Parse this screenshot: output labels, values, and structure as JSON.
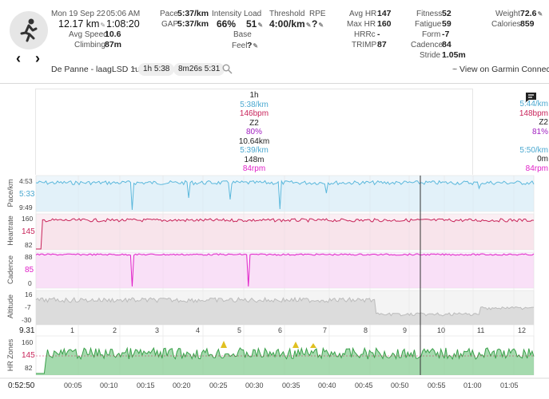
{
  "header": {
    "date": "Mon 19 Sep 22",
    "time": "05:06 AM",
    "distance": "12.17 km",
    "duration": "1:08:20",
    "avg_speed_label": "Avg Speed",
    "avg_speed": "10.6",
    "climbing_label": "Climbing",
    "climbing": "87m",
    "pace_label": "Pace",
    "pace": "5:37/km",
    "gap_label": "GAP",
    "gap": "5:37/km",
    "intensity_label": "Intensity",
    "intensity": "66%",
    "load_label": "Load",
    "load": "51",
    "base_label": "Base",
    "feel_label": "Feel",
    "feel": "?",
    "threshold_label": "Threshold",
    "threshold": "4:00/km",
    "rpe_label": "RPE",
    "rpe": "?",
    "avghr_label": "Avg HR",
    "avghr": "147",
    "maxhr_label": "Max HR",
    "maxhr": "160",
    "hrrc_label": "HRRc",
    "hrrc": "-",
    "trimp_label": "TRIMP",
    "trimp": "87",
    "fitness_label": "Fitness",
    "fitness": "52",
    "fatigue_label": "Fatigue",
    "fatigue": "59",
    "form_label": "Form",
    "form": "-7",
    "cadence_label": "Cadence",
    "cadence": "84",
    "stride_label": "Stride",
    "stride": "1.05m",
    "weight_label": "Weight",
    "weight": "72.6",
    "calories_label": "Calories",
    "calories": "859"
  },
  "nav": {
    "prev": "‹",
    "next": "›"
  },
  "activity": {
    "name": "De Panne - laagLSD 1u",
    "tilde": "~",
    "pill1": "1h 5:38",
    "pill2": "8m26s 5:31",
    "garmin_link": "~ View on Garmin Connect"
  },
  "tooltip1": [
    "1h",
    "5:38/km",
    "146bpm",
    "Z2",
    "80%",
    "10.64km",
    "5:39/km",
    "148m",
    "84rpm"
  ],
  "tooltip2": [
    "5:44/km",
    "148bpm",
    "Z2",
    "81%",
    "5:50/km",
    "0m",
    "84rpm"
  ],
  "charts": {
    "pace": {
      "label": "Pace/km",
      "ticks": [
        "4:53",
        "5:33",
        "9:49"
      ]
    },
    "hr": {
      "label": "Heartrate",
      "ticks": [
        "160",
        "145",
        "82"
      ]
    },
    "cadence": {
      "label": "Cadence",
      "ticks": [
        "88",
        "85",
        "0"
      ]
    },
    "altitude": {
      "label": "Altitude",
      "ticks": [
        "16",
        "-7",
        "-30"
      ]
    },
    "laps": {
      "start": "9.31",
      "items": [
        "1",
        "2",
        "3",
        "4",
        "5",
        "6",
        "7",
        "8",
        "9",
        "10",
        "11",
        "12"
      ]
    },
    "zones": {
      "label": "HR Zones",
      "ticks": [
        "160",
        "145",
        "82"
      ]
    }
  },
  "time_axis": [
    "0:52:50",
    "00:05",
    "00:10",
    "00:15",
    "00:20",
    "00:25",
    "00:30",
    "00:35",
    "00:40",
    "00:45",
    "00:50",
    "00:55",
    "01:00",
    "01:05"
  ],
  "colors": {
    "pace": "#5bb8dc",
    "hr": "#c8245a",
    "cadence": "#e020c8",
    "altitude": "#bbbbbb",
    "zones": "#3aa04a",
    "zone_hi": "#e0c020"
  }
}
